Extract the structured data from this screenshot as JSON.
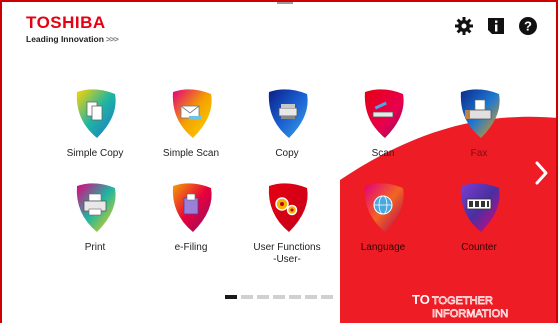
{
  "logo": {
    "brand": "TOSHIBA",
    "tagline": "Leading Innovation",
    "tagline_arrows": ">>>"
  },
  "header": {
    "icons": [
      "settings-icon",
      "info-icon",
      "help-icon"
    ]
  },
  "apps": [
    {
      "label": "Simple Copy",
      "icon": "simple-copy-icon"
    },
    {
      "label": "Simple Scan",
      "icon": "simple-scan-icon"
    },
    {
      "label": "Copy",
      "icon": "copy-icon"
    },
    {
      "label": "Scan",
      "icon": "scan-icon"
    },
    {
      "label": "Fax",
      "icon": "fax-icon"
    },
    {
      "label": "Print",
      "icon": "print-icon"
    },
    {
      "label": "e-Filing",
      "icon": "e-filing-icon"
    },
    {
      "label": "User Functions\n-User-",
      "label_line1": "User Functions",
      "label_line2": "-User-",
      "icon": "user-functions-icon"
    },
    {
      "label": "Language",
      "icon": "language-icon"
    },
    {
      "label": "Counter",
      "icon": "counter-icon"
    }
  ],
  "pagination": {
    "pages": 7,
    "current": 1
  },
  "navigation": {
    "next_icon": "chevron-right-icon"
  },
  "branding": {
    "together_line1": "TOGETHER",
    "together_line2": "INFORMATION",
    "together_prefix": "TO"
  },
  "colors": {
    "brand_red": "#e60012",
    "background": "#ffffff",
    "accent_bg": "#ee1c25"
  }
}
